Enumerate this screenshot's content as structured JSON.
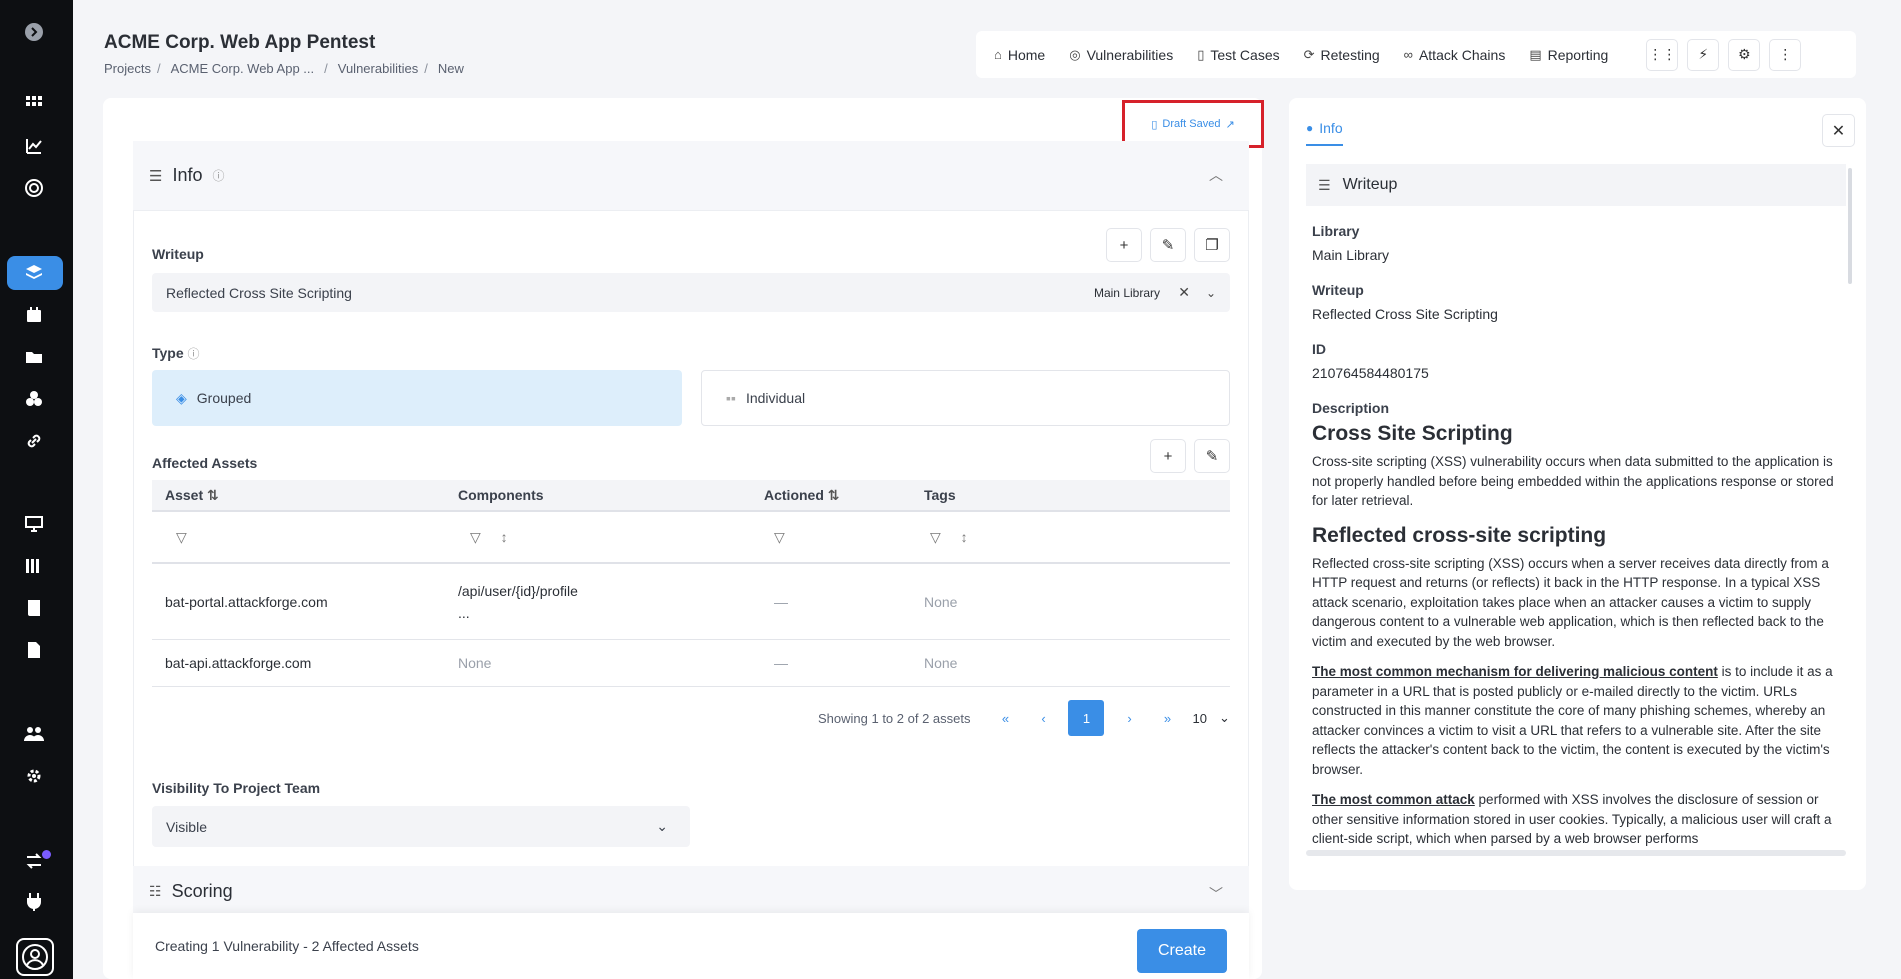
{
  "header": {
    "title": "ACME Corp. Web App Pentest",
    "breadcrumbs": [
      "Projects",
      "ACME Corp. Web App ...",
      "Vulnerabilities",
      "New"
    ]
  },
  "topnav": {
    "items": [
      {
        "label": "Home",
        "icon": "home-icon"
      },
      {
        "label": "Vulnerabilities",
        "icon": "target-icon"
      },
      {
        "label": "Test Cases",
        "icon": "document-icon"
      },
      {
        "label": "Retesting",
        "icon": "refresh-icon"
      },
      {
        "label": "Attack Chains",
        "icon": "link-icon"
      },
      {
        "label": "Reporting",
        "icon": "report-icon"
      }
    ]
  },
  "draft": {
    "label": "Draft Saved"
  },
  "info": {
    "title": "Info",
    "writeup_label": "Writeup",
    "writeup_value": "Reflected Cross Site Scripting",
    "writeup_library": "Main Library",
    "type_label": "Type",
    "type_grouped": "Grouped",
    "type_individual": "Individual",
    "assets_label": "Affected Assets",
    "columns": [
      "Asset",
      "Components",
      "Actioned",
      "Tags"
    ],
    "rows": [
      {
        "asset": "bat-portal.attackforge.com",
        "components": "/api/user/{id}/profile",
        "components_more": "...",
        "actioned": "—",
        "tags": "None"
      },
      {
        "asset": "bat-api.attackforge.com",
        "components": "None",
        "actioned": "—",
        "tags": "None"
      }
    ],
    "pager_text": "Showing 1 to 2 of 2 assets",
    "pager_current": "1",
    "pager_size": "10",
    "visibility_label": "Visibility To Project Team",
    "visibility_value": "Visible"
  },
  "scoring": {
    "title": "Scoring"
  },
  "footer": {
    "creating": "Creating 1 Vulnerability",
    "assets": " - 2 Affected Assets",
    "create_label": "Create"
  },
  "panel": {
    "tab": "Info",
    "section": "Writeup",
    "library_label": "Library",
    "library_value": "Main Library",
    "writeup_label": "Writeup",
    "writeup_value": "Reflected Cross Site Scripting",
    "id_label": "ID",
    "id_value": "210764584480175",
    "description_label": "Description",
    "h1": "Cross Site Scripting",
    "p1": "Cross-site scripting (XSS) vulnerability occurs when data submitted to the application is not properly handled before being embedded within the applications response or stored for later retrieval.",
    "h2": "Reflected cross-site scripting",
    "p2": "Reflected cross-site scripting (XSS) occurs when a server receives data directly from a HTTP request and returns (or reflects) it back in the HTTP response. In a typical XSS attack scenario, exploitation takes place when an attacker causes a victim to supply dangerous content to a vulnerable web application, which is then reflected back to the victim and executed by the web browser.",
    "p3_bold": "The most common mechanism for delivering malicious content",
    "p3": " is to include it as a parameter in a URL that is posted publicly or e-mailed directly to the victim. URLs constructed in this manner constitute the core of many phishing schemes, whereby an attacker convinces a victim to visit a URL that refers to a vulnerable site. After the site reflects the attacker's content back to the victim, the content is executed by the victim's browser.",
    "p4_bold": "The most common attack",
    "p4": " performed with XSS involves the disclosure of session or other sensitive information stored in user cookies. Typically, a malicious user will craft a client-side script, which when parsed by a web browser performs"
  },
  "colors": {
    "accent": "#3a8ee6",
    "highlight": "#d6212a",
    "rail": "#0d0f12"
  }
}
